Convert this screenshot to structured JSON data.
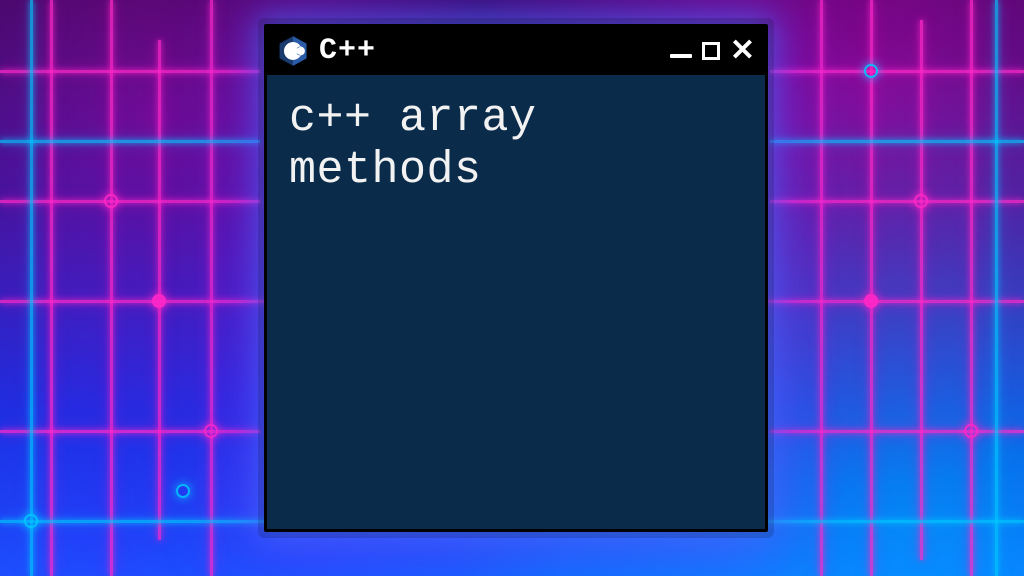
{
  "window": {
    "title": "C++",
    "content": "c++ array\nmethods",
    "icon": "cpp-hex-logo"
  },
  "controls": {
    "minimize": "minimize",
    "maximize": "maximize",
    "close": "close"
  },
  "colors": {
    "window_bg": "#0a2b4a",
    "titlebar_bg": "#000000",
    "text": "#f2f2f2",
    "neon_pink": "#ff28c8",
    "neon_blue": "#00c8ff"
  }
}
